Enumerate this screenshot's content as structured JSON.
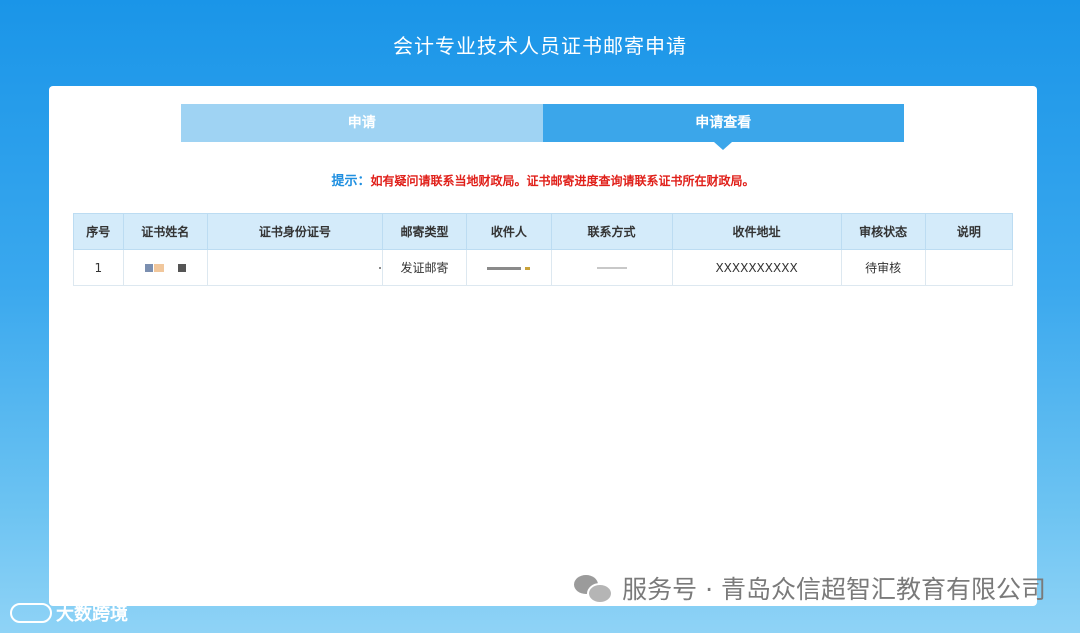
{
  "page": {
    "title": "会计专业技术人员证书邮寄申请"
  },
  "tabs": [
    {
      "label": "申请",
      "active": false
    },
    {
      "label": "申请查看",
      "active": true
    }
  ],
  "notice": {
    "label": "提示：",
    "text": "如有疑问请联系当地财政局。证书邮寄进度查询请联系证书所在财政局。"
  },
  "table": {
    "headers": [
      "序号",
      "证书姓名",
      "证书身份证号",
      "邮寄类型",
      "收件人",
      "联系方式",
      "收件地址",
      "审核状态",
      "说明"
    ],
    "rows": [
      {
        "seq": "1",
        "name": "",
        "id_number": "",
        "mail_type": "发证邮寄",
        "recipient": "",
        "contact": "",
        "address": "XXXXXXXXXX",
        "status": "待审核",
        "note": ""
      }
    ]
  },
  "watermark": {
    "text": "服务号 · 青岛众信超智汇教育有限公司",
    "icon": "wechat-icon"
  },
  "corner_logo": {
    "text": "大数跨境",
    "icon": "logo-icon"
  },
  "colors": {
    "header_blue": "#1a95e8",
    "tab_active": "#3ba6ea",
    "tab_inactive": "#9fd3f3",
    "notice_red": "#e0201a",
    "table_header_bg": "#d4ebfa"
  }
}
